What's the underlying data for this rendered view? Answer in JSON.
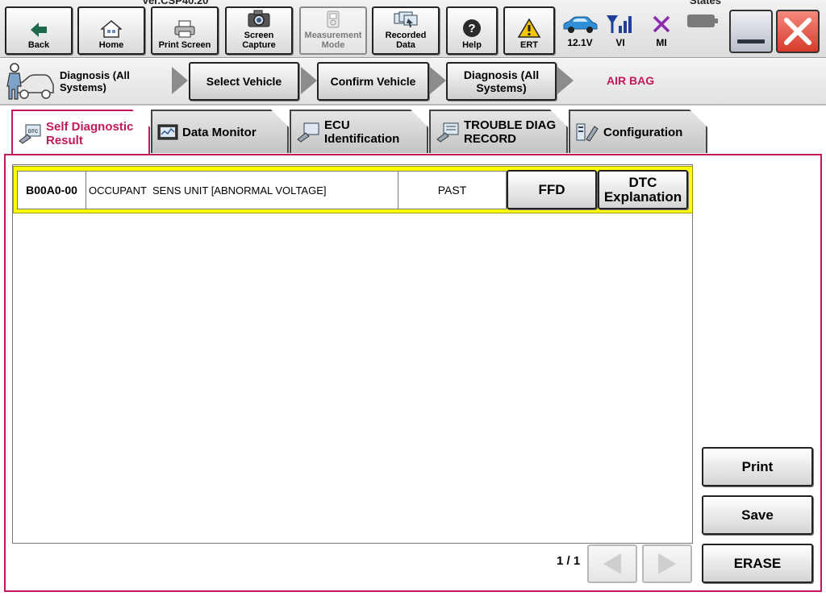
{
  "app": {
    "version_text": "Ver.CSP40.20",
    "states_text": "States"
  },
  "toolbar": {
    "back": "Back",
    "home": "Home",
    "print_screen": "Print Screen",
    "screen_capture_l1": "Screen",
    "screen_capture_l2": "Capture",
    "measurement_l1": "Measurement",
    "measurement_l2": "Mode",
    "recorded_l1": "Recorded",
    "recorded_l2": "Data",
    "help": "Help",
    "ert": "ERT"
  },
  "status": {
    "battery_voltage": "12.1V",
    "vi_label": "VI",
    "mi_label": "MI"
  },
  "breadcrumb": {
    "title_l1": "Diagnosis (All",
    "title_l2": "Systems)",
    "select_vehicle": "Select Vehicle",
    "confirm_vehicle": "Confirm Vehicle",
    "diag_all_l1": "Diagnosis (All",
    "diag_all_l2": "Systems)",
    "current": "AIR BAG"
  },
  "tabs": {
    "self_diag_l1": "Self Diagnostic",
    "self_diag_l2": "Result",
    "data_monitor": "Data Monitor",
    "ecu_l1": "ECU",
    "ecu_l2": "Identification",
    "trouble_l1": "TROUBLE DIAG",
    "trouble_l2": "RECORD",
    "configuration": "Configuration"
  },
  "dtc_rows": [
    {
      "code": "B00A0-00",
      "description": "OCCUPANT  SENS UNIT [ABNORMAL VOLTAGE]",
      "status": "PAST",
      "ffd_label": "FFD",
      "dtc_expl_l1": "DTC",
      "dtc_expl_l2": "Explanation"
    }
  ],
  "actions": {
    "print": "Print",
    "save": "Save",
    "erase": "ERASE"
  },
  "pagination": {
    "page": "1 / 1"
  },
  "colors": {
    "accent": "#c2185b",
    "highlight_row": "#ffff00"
  }
}
